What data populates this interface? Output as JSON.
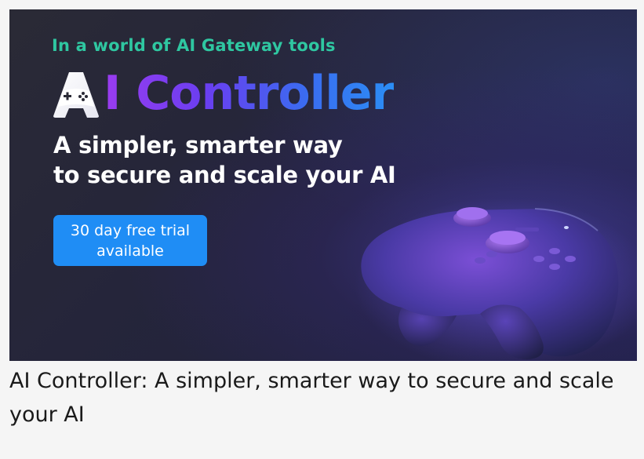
{
  "banner": {
    "tagline": "In a world of AI Gateway tools",
    "logo_text": "I Controller",
    "headline_line1": "A simpler, smarter way",
    "headline_line2": "to secure and scale your AI",
    "cta_line1": "30 day free trial",
    "cta_line2": "available",
    "colors": {
      "tagline": "#2fc7a1",
      "cta_background": "#1f8df5",
      "background": "#25253a",
      "logo_gradient_start": "#9a3cf0",
      "logo_gradient_end": "#2b8ef5"
    },
    "icons": [
      "gamepad-letter-a-icon",
      "gamepad-image"
    ]
  },
  "caption": "AI Controller: A simpler, smarter way to secure and scale your AI"
}
